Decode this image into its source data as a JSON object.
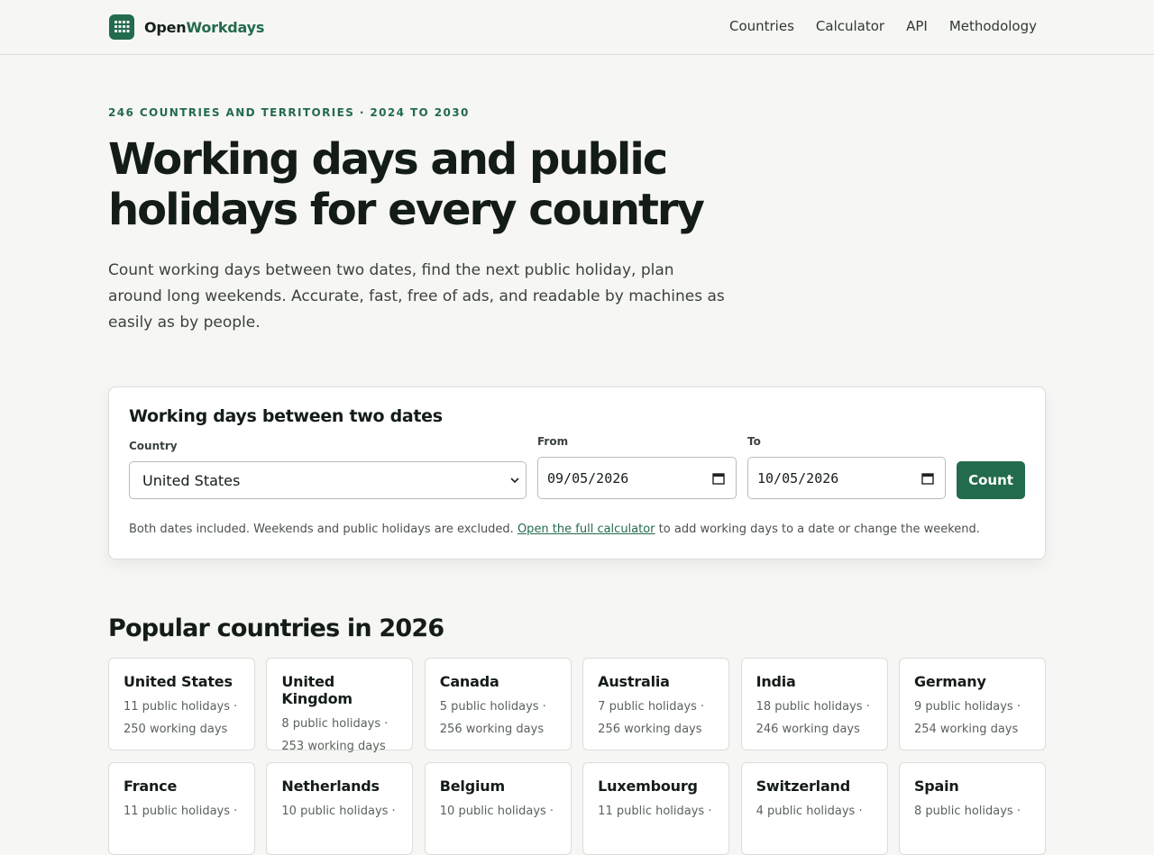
{
  "brand": {
    "name_part1": "Open",
    "name_part2": "Workdays"
  },
  "nav": [
    {
      "label": "Countries"
    },
    {
      "label": "Calculator"
    },
    {
      "label": "API"
    },
    {
      "label": "Methodology"
    }
  ],
  "hero": {
    "eyebrow": "246 COUNTRIES AND TERRITORIES · 2024 TO 2030",
    "headline": "Working days and public holidays for every country",
    "lede": "Count working days between two dates, find the next public holiday, plan around long weekends. Accurate, fast, free of ads, and readable by machines as easily as by people."
  },
  "calculator": {
    "title": "Working days between two dates",
    "country_label": "Country",
    "country_value": "United States",
    "from_label": "From",
    "from_value": "09/05/2026",
    "to_label": "To",
    "to_value": "10/05/2026",
    "button": "Count",
    "hint_before": "Both dates included. Weekends and public holidays are excluded. ",
    "hint_link": "Open the full calculator",
    "hint_after": " to add working days to a date or change the weekend."
  },
  "popular": {
    "title": "Popular countries in 2026",
    "countries": [
      {
        "name": "United States",
        "holidays": "11 public holidays ·",
        "workdays": "250 working days"
      },
      {
        "name": "United Kingdom",
        "holidays": "8 public holidays ·",
        "workdays": "253 working days"
      },
      {
        "name": "Canada",
        "holidays": "5 public holidays ·",
        "workdays": "256 working days"
      },
      {
        "name": "Australia",
        "holidays": "7 public holidays ·",
        "workdays": "256 working days"
      },
      {
        "name": "India",
        "holidays": "18 public holidays ·",
        "workdays": "246 working days"
      },
      {
        "name": "Germany",
        "holidays": "9 public holidays ·",
        "workdays": "254 working days"
      },
      {
        "name": "France",
        "holidays": "11 public holidays ·",
        "workdays": ""
      },
      {
        "name": "Netherlands",
        "holidays": "10 public holidays ·",
        "workdays": ""
      },
      {
        "name": "Belgium",
        "holidays": "10 public holidays ·",
        "workdays": ""
      },
      {
        "name": "Luxembourg",
        "holidays": "11 public holidays ·",
        "workdays": ""
      },
      {
        "name": "Switzerland",
        "holidays": "4 public holidays ·",
        "workdays": ""
      },
      {
        "name": "Spain",
        "holidays": "8 public holidays ·",
        "workdays": ""
      }
    ]
  },
  "colors": {
    "accent": "#236b4d",
    "background": "#f6f6f4",
    "text": "#141c17"
  },
  "icons": {
    "logo": "calendar-grid-icon",
    "select": "chevron-down-icon",
    "date": "calendar-icon"
  }
}
